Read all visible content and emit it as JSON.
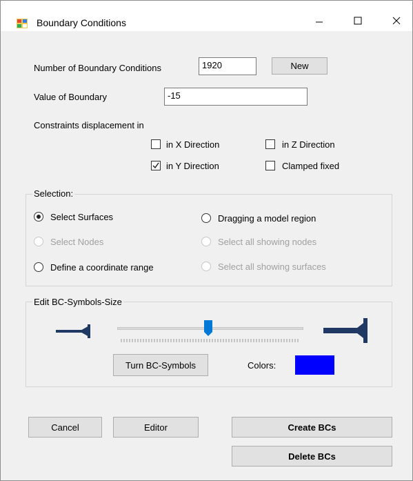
{
  "window": {
    "title": "Boundary Conditions",
    "controls": {
      "minimize": "minimize-icon",
      "maximize": "maximize-icon",
      "close": "close-icon"
    }
  },
  "form": {
    "num_bc_label": "Number of Boundary Conditions",
    "num_bc_value": "1920",
    "new_button": "New",
    "value_label": "Value of Boundary",
    "value_value": "-15",
    "constraints_label": "Constraints displacement in",
    "checkboxes": {
      "x": {
        "label": "in X Direction",
        "checked": false
      },
      "y": {
        "label": "in Y Direction",
        "checked": true
      },
      "z": {
        "label": "in Z Direction",
        "checked": false
      },
      "clamped": {
        "label": "Clamped fixed",
        "checked": false
      }
    }
  },
  "selection": {
    "title": "Selection:",
    "options": {
      "surfaces": {
        "label": "Select Surfaces",
        "selected": true,
        "enabled": true
      },
      "nodes": {
        "label": "Select Nodes",
        "selected": false,
        "enabled": false
      },
      "coord_range": {
        "label": "Define a coordinate range",
        "selected": false,
        "enabled": true
      },
      "drag_region": {
        "label": "Dragging a model region",
        "selected": false,
        "enabled": true
      },
      "all_nodes": {
        "label": "Select all showing nodes",
        "selected": false,
        "enabled": false
      },
      "all_surfaces": {
        "label": "Select all showing surfaces",
        "selected": false,
        "enabled": false
      }
    }
  },
  "symbols": {
    "title": "Edit BC-Symbols-Size",
    "slider_position": 0.49,
    "turn_button": "Turn BC-Symbols",
    "colors_label": "Colors:",
    "color_value": "#0000ff",
    "icon_color": "#1f3864"
  },
  "actions": {
    "cancel": "Cancel",
    "editor": "Editor",
    "create": "Create BCs",
    "delete": "Delete BCs"
  }
}
